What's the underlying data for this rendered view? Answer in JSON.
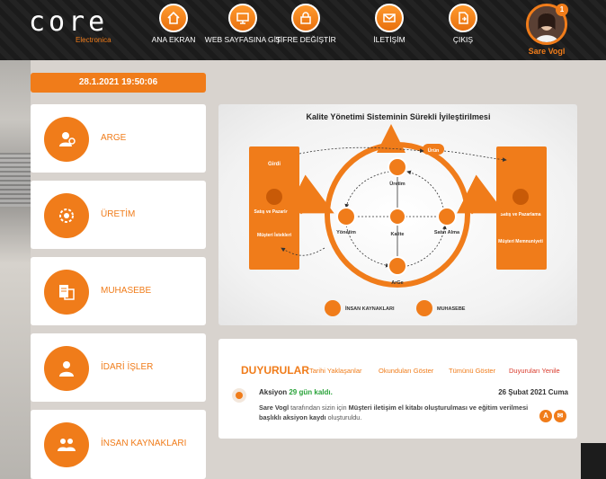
{
  "header": {
    "logo": "core",
    "logo_sub": "Electronica",
    "nav": [
      {
        "label": "ANA EKRAN",
        "icon": "home-icon"
      },
      {
        "label": "WEB SAYFASINA GİT",
        "icon": "monitor-icon"
      },
      {
        "label": "ŞİFRE DEĞİŞTİR",
        "icon": "lock-icon"
      },
      {
        "label": "İLETİŞİM",
        "icon": "mail-icon"
      },
      {
        "label": "ÇIKIŞ",
        "icon": "exit-icon"
      }
    ],
    "user": {
      "name": "Sare Vogl",
      "badge": "1"
    }
  },
  "datetime": "28.1.2021 19:50:06",
  "modules": [
    {
      "label": "ARGE",
      "icon": "researcher-icon"
    },
    {
      "label": "ÜRETİM",
      "icon": "production-gear-icon"
    },
    {
      "label": "MUHASEBE",
      "icon": "accounting-icon"
    },
    {
      "label": "İDARİ İŞLER",
      "icon": "admin-person-icon"
    },
    {
      "label": "İNSAN KAYNAKLARI",
      "icon": "people-icon"
    }
  ],
  "diagram": {
    "title": "Kalite Yönetimi Sisteminin Sürekli İyileştirilmesi",
    "left_box": {
      "top": "Girdi",
      "mid": "Satış ve Pazarlama",
      "bottom": "Müşteri İstekleri"
    },
    "right_box": {
      "mid": "Satış ve Pazarlama",
      "bottom": "Müşteri Memnuniyeti"
    },
    "urun": "Ürün",
    "nodes": {
      "uretim": "Üretim",
      "yonetim": "Yönetim",
      "kalite": "Kalite",
      "satin_alma": "Satın Alma",
      "arge": "ArGe"
    },
    "bottom": {
      "ik": "İNSAN KAYNAKLARI",
      "muhasebe": "MUHASEBE"
    }
  },
  "announcements": {
    "title": "DUYURULAR",
    "links": [
      "Tarihi Yaklaşanlar",
      "Okunduları Göster",
      "Tümünü Göster",
      "Duyuruları Yenile"
    ],
    "item": {
      "label": "Aksiyon",
      "days": "29 gün kaldı.",
      "date": "26 Şubat 2021 Cuma",
      "user": "Sare Vogl",
      "text1": "tarafından sizin için",
      "bold": "Müşteri iletişim el kitabı oluşturulması ve eğitim verilmesi başlıklı aksiyon kaydı",
      "text2": "oluşturuldu.",
      "icon_a": "A"
    }
  },
  "colors": {
    "accent": "#f07c1a",
    "header_bg": "#1f1f1f",
    "page_bg": "#d8d3ce",
    "link_red": "#d93a2b",
    "green": "#2aa33a"
  }
}
